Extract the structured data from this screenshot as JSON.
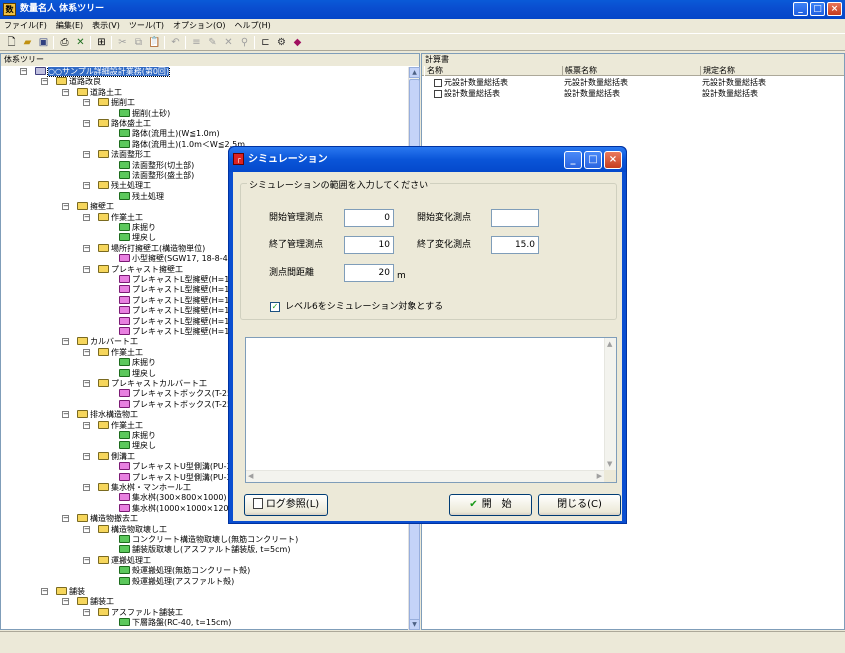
{
  "window": {
    "title": "数量名人  体系ツリー"
  },
  "menu": [
    "ファイル(F)",
    "編集(E)",
    "表示(V)",
    "ツール(T)",
    "オプション(O)",
    "ヘルプ(H)"
  ],
  "left_pane": {
    "label": "体系ツリー"
  },
  "tree": [
    {
      "text": "○○サンプル詳細設計業務(第0回)",
      "d": 0,
      "ic": "root"
    },
    {
      "text": "道路改良",
      "d": 1,
      "ic": "folder"
    },
    {
      "text": "道路土工",
      "d": 2,
      "ic": "folder"
    },
    {
      "text": "掘削工",
      "d": 3,
      "ic": "folder"
    },
    {
      "text": "掘削(土砂)",
      "d": 4,
      "ic": "doc"
    },
    {
      "text": "路体盛土工",
      "d": 3,
      "ic": "folder"
    },
    {
      "text": "路体(流用土)(W≦1.0m)",
      "d": 4,
      "ic": "doc"
    },
    {
      "text": "路体(流用土)(1.0m＜W≦2.5m",
      "d": 4,
      "ic": "doc"
    },
    {
      "text": "法面整形工",
      "d": 3,
      "ic": "folder"
    },
    {
      "text": "法面整形(切土部)",
      "d": 4,
      "ic": "doc"
    },
    {
      "text": "法面整形(盛土部)",
      "d": 4,
      "ic": "doc"
    },
    {
      "text": "残土処理工",
      "d": 3,
      "ic": "folder"
    },
    {
      "text": "残土処理",
      "d": 4,
      "ic": "doc"
    },
    {
      "text": "擁壁工",
      "d": 2,
      "ic": "folder"
    },
    {
      "text": "作業土工",
      "d": 3,
      "ic": "folder"
    },
    {
      "text": "床掘り",
      "d": 4,
      "ic": "doc"
    },
    {
      "text": "埋戻し",
      "d": 4,
      "ic": "doc"
    },
    {
      "text": "場所打擁壁工(構造物単位)",
      "d": 3,
      "ic": "folder"
    },
    {
      "text": "小型擁壁(SGW17, 18-8-40,",
      "d": 4,
      "ic": "pink"
    },
    {
      "text": "プレキャスト擁壁工",
      "d": 3,
      "ic": "folder"
    },
    {
      "text": "プレキャストL型擁壁(H=1100",
      "d": 4,
      "ic": "pink"
    },
    {
      "text": "プレキャストL型擁壁(H=1200",
      "d": 4,
      "ic": "pink"
    },
    {
      "text": "プレキャストL型擁壁(H=1300",
      "d": 4,
      "ic": "pink"
    },
    {
      "text": "プレキャストL型擁壁(H=1400",
      "d": 4,
      "ic": "pink"
    },
    {
      "text": "プレキャストL型擁壁(H=1500",
      "d": 4,
      "ic": "pink"
    },
    {
      "text": "プレキャストL型擁壁(H=1600",
      "d": 4,
      "ic": "pink"
    },
    {
      "text": "カルバート工",
      "d": 2,
      "ic": "folder"
    },
    {
      "text": "作業土工",
      "d": 3,
      "ic": "folder"
    },
    {
      "text": "床掘り",
      "d": 4,
      "ic": "doc"
    },
    {
      "text": "埋戻し",
      "d": 4,
      "ic": "doc"
    },
    {
      "text": "プレキャストカルバート工",
      "d": 3,
      "ic": "folder"
    },
    {
      "text": "プレキャストボックス(T-25, 3",
      "d": 4,
      "ic": "pink"
    },
    {
      "text": "プレキャストボックス(T-25, 4",
      "d": 4,
      "ic": "pink"
    },
    {
      "text": "排水構造物工",
      "d": 2,
      "ic": "folder"
    },
    {
      "text": "作業土工",
      "d": 3,
      "ic": "folder"
    },
    {
      "text": "床掘り",
      "d": 4,
      "ic": "doc"
    },
    {
      "text": "埋戻し",
      "d": 4,
      "ic": "doc"
    },
    {
      "text": "側溝工",
      "d": 3,
      "ic": "folder"
    },
    {
      "text": "プレキャストU型側溝(PU-300",
      "d": 4,
      "ic": "pink"
    },
    {
      "text": "プレキャストU型側溝(PU-360",
      "d": 4,
      "ic": "pink"
    },
    {
      "text": "集水桝・マンホール工",
      "d": 3,
      "ic": "folder"
    },
    {
      "text": "集水桝(300×800×1000)",
      "d": 4,
      "ic": "pink"
    },
    {
      "text": "集水桝(1000×1000×1200)",
      "d": 4,
      "ic": "pink"
    },
    {
      "text": "構造物撤去工",
      "d": 2,
      "ic": "folder"
    },
    {
      "text": "構造物取壊し工",
      "d": 3,
      "ic": "folder"
    },
    {
      "text": "コンクリート構造物取壊し(無筋コンクリート)",
      "d": 4,
      "ic": "doc"
    },
    {
      "text": "舗装版取壊し(アスファルト舗装版, t=5cm)",
      "d": 4,
      "ic": "doc"
    },
    {
      "text": "運搬処理工",
      "d": 3,
      "ic": "folder"
    },
    {
      "text": "殻運搬処理(無筋コンクリート殻)",
      "d": 4,
      "ic": "doc"
    },
    {
      "text": "殻運搬処理(アスファルト殻)",
      "d": 4,
      "ic": "doc"
    },
    {
      "text": "舗装",
      "d": 1,
      "ic": "folder"
    },
    {
      "text": "舗装工",
      "d": 2,
      "ic": "folder"
    },
    {
      "text": "アスファルト舗装工",
      "d": 3,
      "ic": "folder"
    },
    {
      "text": "下層路盤(RC-40, t=15cm)",
      "d": 4,
      "ic": "doc"
    }
  ],
  "right_pane": {
    "label": "計算書",
    "columns": [
      "名称",
      "帳票名称",
      "規定名称"
    ],
    "rows": [
      [
        "元設計数量総括表",
        "元設計数量総括表",
        "元設計数量総括表"
      ],
      [
        "設計数量総括表",
        "設計数量総括表",
        "設計数量総括表"
      ]
    ]
  },
  "dialog": {
    "title": "シミュレーション",
    "group_label": "シミュレーションの範囲を入力してください",
    "start_manage_label": "開始管理測点",
    "start_manage_value": "0",
    "start_change_label": "開始変化測点",
    "start_change_value": "",
    "end_manage_label": "終了管理測点",
    "end_manage_value": "10",
    "end_change_label": "終了変化測点",
    "end_change_value": "15.0",
    "interval_label": "測点間距離",
    "interval_value": "20",
    "interval_unit": "m",
    "level6_label": "レベル6をシミュレーション対象とする",
    "level6_checked": true,
    "log_button": "ログ参照(L)",
    "start_button": "開　始",
    "close_button": "閉じる(C)"
  },
  "colors": {
    "titlebar": "#0a4ed0",
    "desktop": "#ece9d8"
  }
}
